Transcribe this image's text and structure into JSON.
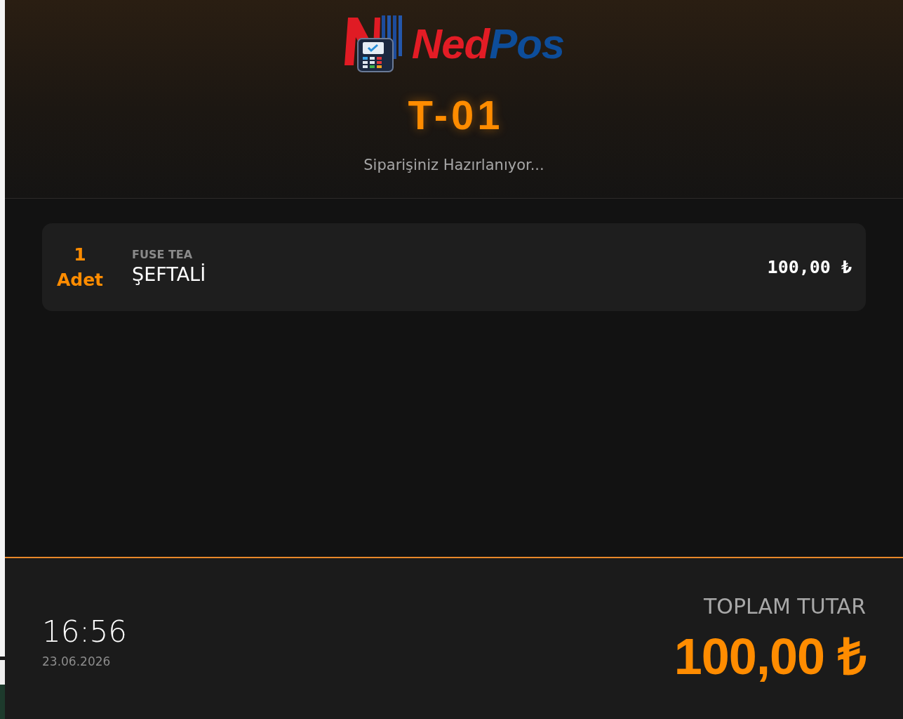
{
  "logo": {
    "parts": [
      "Ned",
      "Pos"
    ]
  },
  "order": {
    "number": "T-01",
    "status": "Siparişiniz Hazırlanıyor..."
  },
  "items": [
    {
      "quantity": "1",
      "unit": "Adet",
      "brand": "FUSE TEA",
      "name": "ŞEFTALİ",
      "price": "100,00 ₺"
    }
  ],
  "footer": {
    "time": "16:56",
    "date": "23.06.2026",
    "total_label": "TOPLAM TUTAR",
    "total": "100,00 ₺"
  }
}
